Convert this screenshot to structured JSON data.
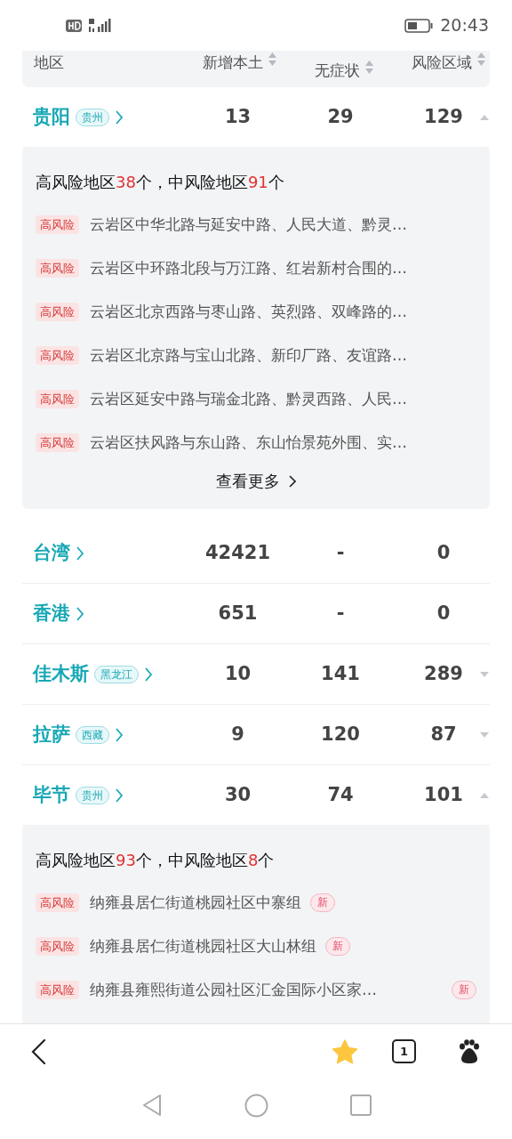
{
  "status_bar": {
    "time": "20:43"
  },
  "table": {
    "columns": [
      {
        "label": "地区",
        "sortable": false
      },
      {
        "label": "新增本土",
        "sortable": true
      },
      {
        "label": "无症状",
        "sortable": true
      },
      {
        "label": "风险区域",
        "sortable": true
      }
    ],
    "rows": [
      {
        "city": "贵阳",
        "province": "贵州",
        "new_local": "13",
        "asymptomatic": "29",
        "risk_areas": "129",
        "expanded": true,
        "details": {
          "summary": [
            {
              "text": "高风险地区",
              "highlight": false
            },
            {
              "text": "38",
              "highlight": true
            },
            {
              "text": "个，中风险地区",
              "highlight": false
            },
            {
              "text": "91",
              "highlight": true
            },
            {
              "text": "个",
              "highlight": false
            }
          ],
          "items": [
            {
              "tag": "高风险",
              "text": "云岩区中华北路与延安中路、人民大道、黔灵…"
            },
            {
              "tag": "高风险",
              "text": "云岩区中环路北段与万江路、红岩新村合围的…"
            },
            {
              "tag": "高风险",
              "text": "云岩区北京西路与枣山路、英烈路、双峰路的…"
            },
            {
              "tag": "高风险",
              "text": "云岩区北京路与宝山北路、新印厂路、友谊路…"
            },
            {
              "tag": "高风险",
              "text": "云岩区延安中路与瑞金北路、黔灵西路、人民…"
            },
            {
              "tag": "高风险",
              "text": "云岩区扶风路与东山路、东山怡景苑外围、实…"
            }
          ],
          "more": "查看更多"
        }
      },
      {
        "city": "台湾",
        "new_local": "42421",
        "asymptomatic": "-",
        "risk_areas": "0"
      },
      {
        "city": "香港",
        "new_local": "651",
        "asymptomatic": "-",
        "risk_areas": "0"
      },
      {
        "city": "佳木斯",
        "province": "黑龙江",
        "new_local": "10",
        "asymptomatic": "141",
        "risk_areas": "289",
        "expanded": false
      },
      {
        "city": "拉萨",
        "province": "西藏",
        "new_local": "9",
        "asymptomatic": "120",
        "risk_areas": "87",
        "expanded": false
      },
      {
        "city": "毕节",
        "province": "贵州",
        "new_local": "30",
        "asymptomatic": "74",
        "risk_areas": "101",
        "expanded": true,
        "details": {
          "summary": [
            {
              "text": "高风险地区",
              "highlight": false
            },
            {
              "text": "93",
              "highlight": true
            },
            {
              "text": "个，中风险地区",
              "highlight": false
            },
            {
              "text": "8",
              "highlight": true
            },
            {
              "text": "个",
              "highlight": false
            }
          ],
          "items": [
            {
              "tag": "高风险",
              "text": "纳雍县居仁街道桃园社区中寨组",
              "badge": "新"
            },
            {
              "tag": "高风险",
              "text": "纳雍县居仁街道桃园社区大山林组",
              "badge": "新"
            },
            {
              "tag": "高风险",
              "text": "纳雍县雍熙街道公园社区汇金国际小区家…",
              "badge": "新"
            }
          ]
        }
      }
    ]
  },
  "toolbar": {
    "bookmarked": true,
    "tab_count": "1"
  }
}
